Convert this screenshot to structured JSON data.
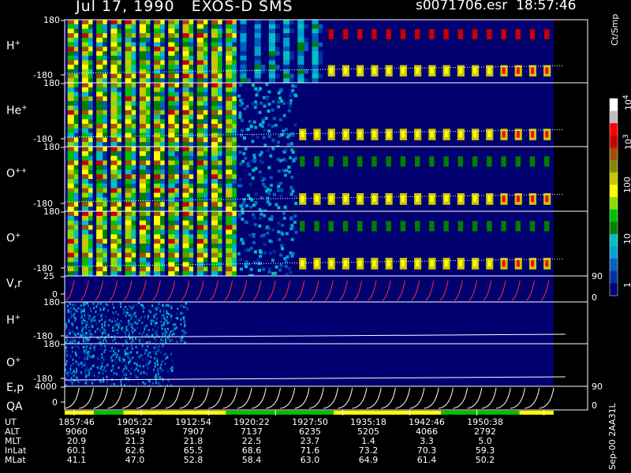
{
  "header": {
    "title": "Jul 17, 1990   EXOS-D SMS",
    "file": "s0071706.esr",
    "time": "18:57:46"
  },
  "panels": [
    {
      "key": "h1",
      "label": "H",
      "sup": "+",
      "ymax": "180",
      "ymin": "-180"
    },
    {
      "key": "he",
      "label": "He",
      "sup": "+",
      "ymax": "180",
      "ymin": "-180"
    },
    {
      "key": "opp",
      "label": "O",
      "sup": "++",
      "ymax": "180",
      "ymin": "-180"
    },
    {
      "key": "o1",
      "label": "O",
      "sup": "+",
      "ymax": "180",
      "ymin": "-180"
    },
    {
      "key": "vr",
      "label": "V,r",
      "sup": "",
      "ymax": "25",
      "ymin": "0",
      "rmax": "90",
      "rmin": "0"
    },
    {
      "key": "h2",
      "label": "H",
      "sup": "+",
      "ymax": "180",
      "ymin": "-180"
    },
    {
      "key": "o2",
      "label": "O",
      "sup": "+",
      "ymax": "180",
      "ymin": "-180"
    },
    {
      "key": "ep",
      "label": "E,p",
      "sup": "",
      "ymax": "4000",
      "ymin": "0",
      "rmax": "90",
      "rmin": "0"
    }
  ],
  "qa_label": "QA",
  "colorbar": {
    "unit": "Ct/Smp",
    "ticks": [
      "10",
      "10",
      "100",
      "10",
      "1"
    ],
    "tick_sups": [
      "4",
      "3",
      "",
      "",
      ""
    ],
    "colors": [
      "#ffffff",
      "#c0c0c0",
      "#ff0000",
      "#c80000",
      "#a05000",
      "#888800",
      "#c8c800",
      "#ffff00",
      "#88e000",
      "#00c000",
      "#008000",
      "#00c0c0",
      "#00a0d0",
      "#0060c0",
      "#0030a0",
      "#000070"
    ]
  },
  "orbit": {
    "rows": [
      {
        "name": "UT",
        "values": [
          "1857:46",
          "1905:22",
          "1912:54",
          "1920:22",
          "1927:50",
          "1935:18",
          "1942:46",
          "1950:38"
        ]
      },
      {
        "name": "ALT",
        "values": [
          "9060",
          "8549",
          "7907",
          "7137",
          "6235",
          "5205",
          "4066",
          "2792"
        ]
      },
      {
        "name": "MLT",
        "values": [
          "20.9",
          "21.3",
          "21.8",
          "22.5",
          "23.7",
          "1.4",
          "3.3",
          "5.0"
        ]
      },
      {
        "name": "InLat",
        "values": [
          "60.1",
          "62.6",
          "65.5",
          "68.6",
          "71.6",
          "73.2",
          "70.3",
          "59.3"
        ]
      },
      {
        "name": "MLat",
        "values": [
          "41.1",
          "47.0",
          "52.8",
          "58.4",
          "63.0",
          "64.9",
          "61.4",
          "50.2"
        ]
      }
    ]
  },
  "footer_id": "Sep-00 2AA31L",
  "chart_data": {
    "type": "heatmap",
    "panels": [
      "H+",
      "He+",
      "O++",
      "O+",
      "V,r",
      "H+",
      "O+",
      "E,p"
    ],
    "x_ticks": [
      "1857:46",
      "1905:22",
      "1912:54",
      "1920:22",
      "1927:50",
      "1935:18",
      "1942:46",
      "1950:38"
    ],
    "colorbar_range": [
      1,
      10000
    ],
    "colorbar_scale": "log",
    "spin_count": 34,
    "data_end_fraction": 0.935
  }
}
